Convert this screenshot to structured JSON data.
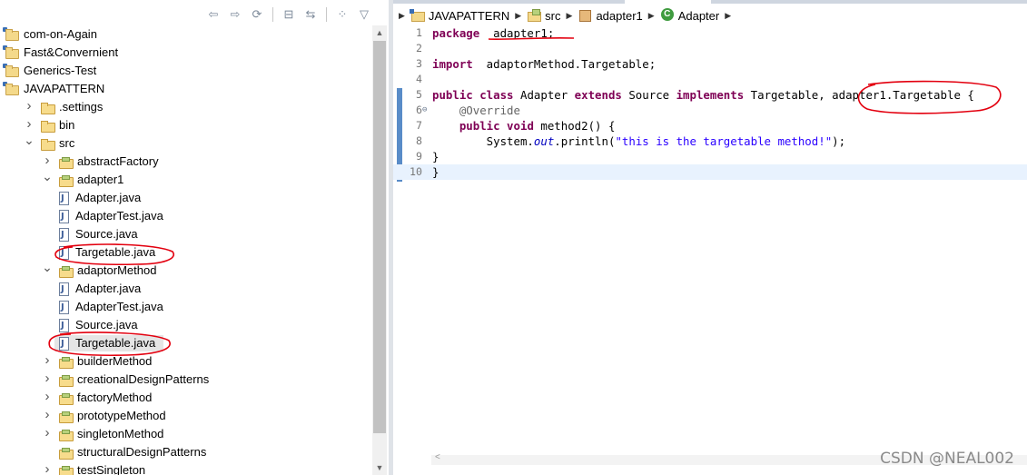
{
  "explorer": {
    "toolbar": [
      {
        "icon": "back-arrow-icon",
        "glyph": "⇦"
      },
      {
        "icon": "forward-arrow-icon",
        "glyph": "⇨"
      },
      {
        "icon": "refresh-icon",
        "glyph": "⟳"
      },
      {
        "icon": "collapse-all-icon",
        "glyph": "⊟"
      },
      {
        "icon": "link-with-editor-icon",
        "glyph": "⇆"
      },
      {
        "icon": "filter-icon",
        "glyph": "⁘"
      },
      {
        "icon": "view-menu-icon",
        "glyph": "▽"
      }
    ],
    "tree": [
      {
        "label": "com-on-Again",
        "type": "project",
        "level": 0,
        "twisty": ""
      },
      {
        "label": "Fast&Convernient",
        "type": "project",
        "level": 0,
        "twisty": ""
      },
      {
        "label": "Generics-Test",
        "type": "project",
        "level": 0,
        "twisty": ""
      },
      {
        "label": "JAVAPATTERN",
        "type": "project",
        "level": 0,
        "twisty": ""
      },
      {
        "label": ".settings",
        "type": "folder",
        "level": 1,
        "twisty": "collapsed"
      },
      {
        "label": "bin",
        "type": "folder",
        "level": 1,
        "twisty": "collapsed"
      },
      {
        "label": "src",
        "type": "folder",
        "level": 1,
        "twisty": "expanded"
      },
      {
        "label": "abstractFactory",
        "type": "folder",
        "level": 2,
        "twisty": "collapsed"
      },
      {
        "label": "adapter1",
        "type": "folder",
        "level": 2,
        "twisty": "expanded"
      },
      {
        "label": "Adapter.java",
        "type": "java",
        "level": 3,
        "twisty": ""
      },
      {
        "label": "AdapterTest.java",
        "type": "java",
        "level": 3,
        "twisty": ""
      },
      {
        "label": "Source.java",
        "type": "java",
        "level": 3,
        "twisty": ""
      },
      {
        "label": "Targetable.java",
        "type": "java",
        "level": 3,
        "twisty": ""
      },
      {
        "label": "adaptorMethod",
        "type": "folder",
        "level": 2,
        "twisty": "expanded"
      },
      {
        "label": "Adapter.java",
        "type": "java",
        "level": 3,
        "twisty": ""
      },
      {
        "label": "AdapterTest.java",
        "type": "java",
        "level": 3,
        "twisty": ""
      },
      {
        "label": "Source.java",
        "type": "java",
        "level": 3,
        "twisty": ""
      },
      {
        "label": "Targetable.java",
        "type": "java",
        "level": 3,
        "twisty": "",
        "selected": true
      },
      {
        "label": "builderMethod",
        "type": "folder",
        "level": 2,
        "twisty": "collapsed"
      },
      {
        "label": "creationalDesignPatterns",
        "type": "folder",
        "level": 2,
        "twisty": "collapsed"
      },
      {
        "label": "factoryMethod",
        "type": "folder",
        "level": 2,
        "twisty": "collapsed"
      },
      {
        "label": "prototypeMethod",
        "type": "folder",
        "level": 2,
        "twisty": "collapsed"
      },
      {
        "label": "singletonMethod",
        "type": "folder",
        "level": 2,
        "twisty": "collapsed"
      },
      {
        "label": "structuralDesignPatterns",
        "type": "folder",
        "level": 2,
        "twisty": ""
      },
      {
        "label": "testSingleton",
        "type": "folder",
        "level": 2,
        "twisty": "collapsed"
      }
    ]
  },
  "breadcrumb": [
    {
      "label": "JAVAPATTERN",
      "icon": "project-icon"
    },
    {
      "label": "src",
      "icon": "source-folder-icon"
    },
    {
      "label": "adapter1",
      "icon": "package-icon"
    },
    {
      "label": "Adapter",
      "icon": "class-icon"
    }
  ],
  "code_lines": [
    {
      "n": "1",
      "fold": "",
      "segs": [
        [
          "kw",
          "package"
        ],
        [
          "",
          "  adapter1;"
        ]
      ]
    },
    {
      "n": "2",
      "fold": "",
      "segs": []
    },
    {
      "n": "3",
      "fold": "",
      "segs": [
        [
          "kw",
          "import"
        ],
        [
          "",
          "  adaptorMethod.Targetable;"
        ]
      ]
    },
    {
      "n": "4",
      "fold": "",
      "segs": []
    },
    {
      "n": "5",
      "fold": "",
      "segs": [
        [
          "kw",
          "public class"
        ],
        [
          "",
          " Adapter "
        ],
        [
          "kw",
          "extends"
        ],
        [
          "",
          " Source "
        ],
        [
          "kw",
          "implements"
        ],
        [
          "",
          " Targetable, adapter1.Targetable {"
        ]
      ]
    },
    {
      "n": "6",
      "fold": "⊖",
      "segs": [
        [
          "",
          "    "
        ],
        [
          "ann",
          "@Override"
        ]
      ]
    },
    {
      "n": "7",
      "fold": "",
      "segs": [
        [
          "",
          "    "
        ],
        [
          "kw",
          "public void"
        ],
        [
          "",
          " method2() {"
        ]
      ]
    },
    {
      "n": "8",
      "fold": "",
      "segs": [
        [
          "",
          "        System."
        ],
        [
          "fld",
          "out"
        ],
        [
          "",
          ".println("
        ],
        [
          "str",
          "\"this is the targetable method!\""
        ],
        [
          "",
          ");"
        ]
      ]
    },
    {
      "n": "9",
      "fold": "",
      "segs": [
        [
          "",
          "}"
        ]
      ]
    },
    {
      "n": "10",
      "fold": "",
      "segs": [
        [
          "",
          "}"
        ]
      ],
      "current": true
    }
  ],
  "watermark": "CSDN @NEAL002"
}
